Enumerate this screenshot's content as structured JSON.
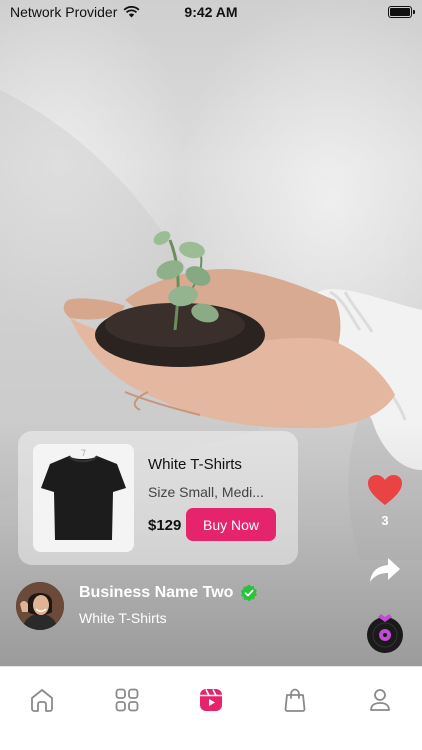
{
  "status_bar": {
    "carrier": "Network Provider",
    "time": "9:42 AM",
    "battery_level": 1.0
  },
  "product": {
    "title": "White T-Shirts",
    "subtitle": "Size Small, Medi...",
    "price": "$129",
    "buy_label": "Buy Now",
    "thumbnail_icon": "tshirt-image"
  },
  "actions": {
    "like_count": "3",
    "like_icon": "heart-icon",
    "share_icon": "share-icon",
    "music_icon": "music-disc-icon"
  },
  "business": {
    "name": "Business Name Two",
    "subtitle": "White T-Shirts",
    "verified": true
  },
  "nav": {
    "items": [
      {
        "id": "home",
        "icon": "home-icon",
        "active": false
      },
      {
        "id": "categories",
        "icon": "grid-icon",
        "active": false
      },
      {
        "id": "reels",
        "icon": "reels-icon",
        "active": true
      },
      {
        "id": "shop",
        "icon": "shopping-bag-icon",
        "active": false
      },
      {
        "id": "profile",
        "icon": "user-icon",
        "active": false
      }
    ]
  },
  "colors": {
    "accent": "#e5246b",
    "like": "#e94343",
    "verified": "#2bc23b"
  }
}
